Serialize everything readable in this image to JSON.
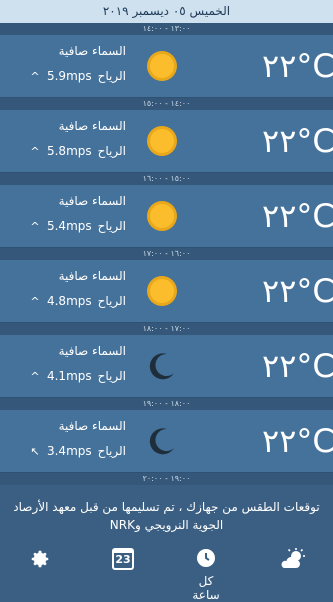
{
  "top_date": "الخميس ٠٥ ديسمبر ٢٠١٩",
  "rows": [
    {
      "range": "١٣:٠٠ - ١٤:٠٠",
      "temp": "٢٢°C",
      "condition": "السماء صافية",
      "wind_label": "الرياح",
      "wind_speed": "5.9mps",
      "icon": "sun-icon",
      "wind_arrow": "^"
    },
    {
      "range": "١٤:٠٠ - ١٥:٠٠",
      "temp": "٢٢°C",
      "condition": "السماء صافية",
      "wind_label": "الرياح",
      "wind_speed": "5.8mps",
      "icon": "sun-icon",
      "wind_arrow": "^"
    },
    {
      "range": "١٥:٠٠ - ١٦:٠٠",
      "temp": "٢٢°C",
      "condition": "السماء صافية",
      "wind_label": "الرياح",
      "wind_speed": "5.4mps",
      "icon": "sun-icon",
      "wind_arrow": "^"
    },
    {
      "range": "١٦:٠٠ - ١٧:٠٠",
      "temp": "٢٢°C",
      "condition": "السماء صافية",
      "wind_label": "الرياح",
      "wind_speed": "4.8mps",
      "icon": "sun-icon",
      "wind_arrow": "^"
    },
    {
      "range": "١٧:٠٠ - ١٨:٠٠",
      "temp": "٢٢°C",
      "condition": "السماء صافية",
      "wind_label": "الرياح",
      "wind_speed": "4.1mps",
      "icon": "moon-icon",
      "wind_arrow": "^"
    },
    {
      "range": "١٨:٠٠ - ١٩:٠٠",
      "temp": "٢٢°C",
      "condition": "السماء صافية",
      "wind_label": "الرياح",
      "wind_speed": "3.4mps",
      "icon": "moon-icon",
      "wind_arrow": "↖"
    }
  ],
  "last_divider": "١٩:٠٠ - ٢٠:٠٠",
  "footer_text": "توقعات الطقس من جهازك ، تم تسليمها من قبل معهد الأرصاد الجوية النرويجي وNRK",
  "bottom_nav": {
    "settings_icon": "gear-icon",
    "calendar_icon": "calendar-icon",
    "calendar_day": "23",
    "hourly_icon": "clock-icon",
    "hourly_label": "كل ساعة",
    "weather_icon": "sun-cloud-icon"
  },
  "colors": {
    "accent": "#f6b21a",
    "sun": "#fbbd2c",
    "background": "#3b5f82",
    "card": "#45729b",
    "topbar": "#cfe0ee"
  }
}
